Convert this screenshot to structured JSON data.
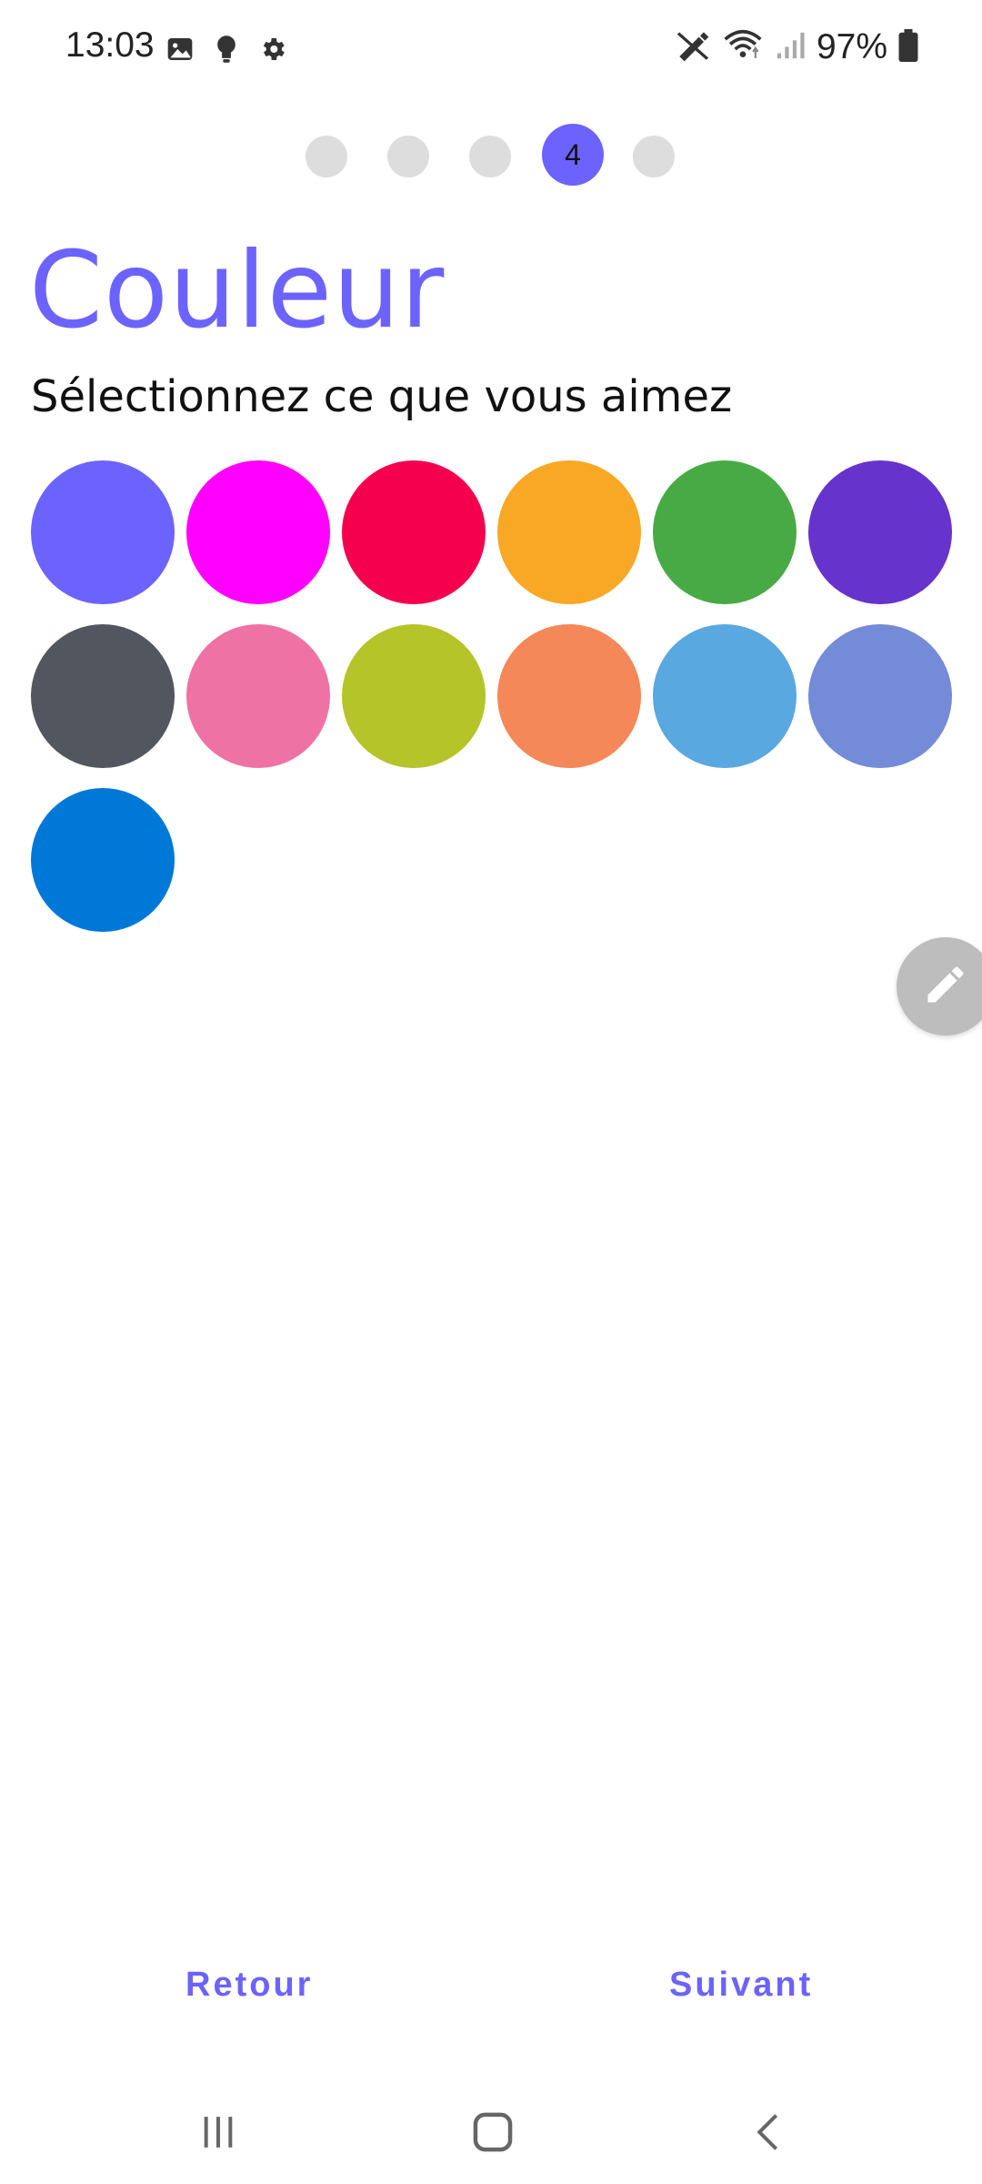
{
  "status_bar": {
    "time": "13:03",
    "left_icons": [
      "image-icon",
      "bulb-icon",
      "gear-icon"
    ],
    "right_icons": [
      "no-sync-icon",
      "wifi-icon",
      "signal-icon"
    ],
    "battery_percent": "97%"
  },
  "stepper": {
    "total_steps": 5,
    "current_step": 4,
    "current_label": "4"
  },
  "header": {
    "title": "Couleur",
    "subtitle": "Sélectionnez ce que vous aimez"
  },
  "colors": [
    "#6c63ff",
    "#ff00ff",
    "#f5004f",
    "#f9a825",
    "#47aa44",
    "#6633cc",
    "#52565f",
    "#ef72a4",
    "#b5c429",
    "#f48858",
    "#59a8e0",
    "#748bd8",
    "#0078d7"
  ],
  "theme": {
    "accent": "#6c63ff"
  },
  "fab": {
    "icon": "pencil-icon"
  },
  "footer": {
    "back_label": "Retour",
    "next_label": "Suivant"
  },
  "nav_bar": {
    "icons": [
      "recents-icon",
      "home-icon",
      "back-icon"
    ]
  }
}
